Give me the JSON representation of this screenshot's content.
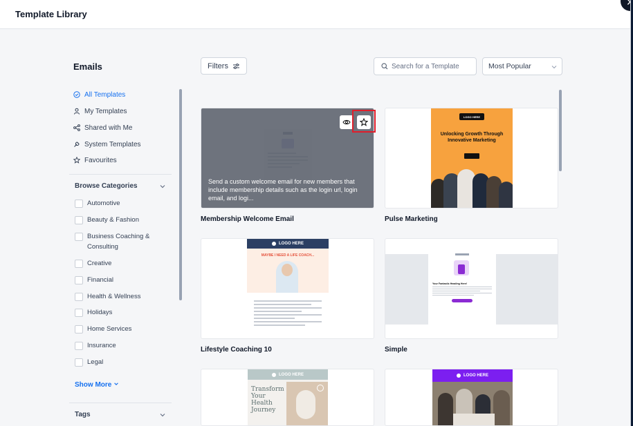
{
  "header": {
    "title": "Template Library",
    "close_icon": "close-icon"
  },
  "sidebar": {
    "section_title": "Emails",
    "nav": [
      {
        "label": "All Templates",
        "icon": "check-circle-icon",
        "active": true
      },
      {
        "label": "My Templates",
        "icon": "user-icon"
      },
      {
        "label": "Shared with Me",
        "icon": "share-icon"
      },
      {
        "label": "System Templates",
        "icon": "wrench-icon"
      },
      {
        "label": "Favourites",
        "icon": "star-icon"
      }
    ],
    "browse_title": "Browse Categories",
    "categories": [
      "Automotive",
      "Beauty & Fashion",
      "Business Coaching & Consulting",
      "Creative",
      "Financial",
      "Health & Wellness",
      "Holidays",
      "Home Services",
      "Insurance",
      "Legal"
    ],
    "show_more": "Show More",
    "tags_title": "Tags"
  },
  "toolbar": {
    "filters_label": "Filters",
    "search_placeholder": "Search for a Template",
    "sort_value": "Most Popular"
  },
  "cards": [
    {
      "name": "Membership Welcome Email",
      "description": "Send a custom welcome email for new members that include membership details such as the login url, login email, and logi..."
    },
    {
      "name": "Pulse Marketing",
      "heading": "Unlocking Growth Through Innovative Marketing",
      "logo": "LOGO HERE"
    },
    {
      "name": "Lifestyle Coaching 10",
      "logo": "LOGO HERE",
      "banner": "MAYBE I NEED A LIFE COACH..."
    },
    {
      "name": "Simple",
      "heading": "Your Fantastic Heading Here!"
    },
    {
      "name": "",
      "logo": "LOGO HERE",
      "heading": "Transform Your Health Journey"
    },
    {
      "name": "",
      "logo": "LOGO HERE"
    }
  ],
  "colors": {
    "accent": "#1570ef",
    "highlight": "#e11d2a",
    "orange": "#f7a23e",
    "navy": "#2b3f63",
    "purple": "#7c1ff0"
  }
}
